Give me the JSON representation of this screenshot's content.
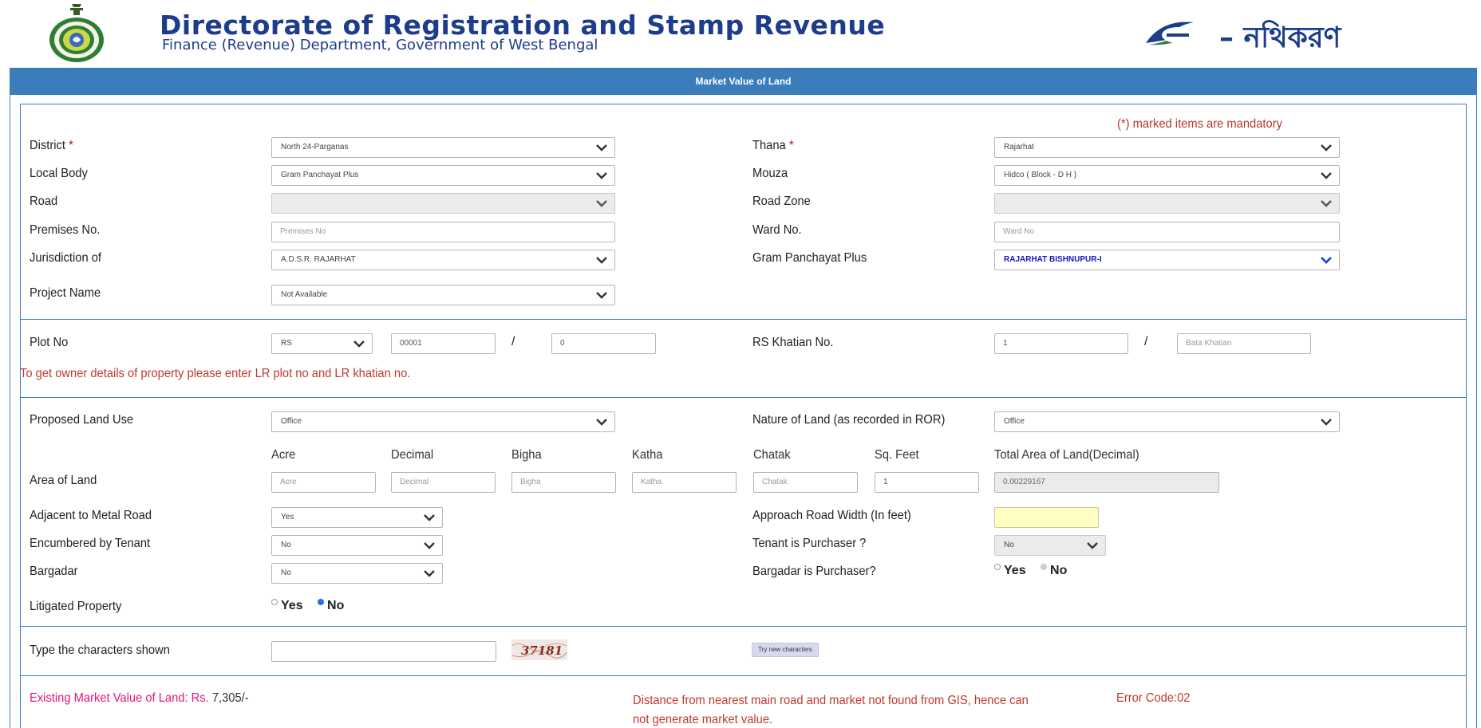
{
  "header": {
    "title": "Directorate of Registration and Stamp Revenue",
    "subtitle": "Finance (Revenue) Department, Government of West Bengal",
    "logo_text": "– নথিকরণ"
  },
  "bar_title": "Market Value of Land",
  "mandatory_note": "(*) marked items are mandatory",
  "required_mark": "*",
  "fields": {
    "district": {
      "label": "District",
      "value": "North 24-Parganas"
    },
    "thana": {
      "label": "Thana",
      "value": "Rajarhat"
    },
    "local_body": {
      "label": "Local Body",
      "value": "Gram Panchayat Plus"
    },
    "mouza": {
      "label": "Mouza",
      "value": "Hidco ( Block - D H )"
    },
    "road": {
      "label": "Road",
      "value": ""
    },
    "road_zone": {
      "label": "Road Zone",
      "value": ""
    },
    "premises_no": {
      "label": "Premises No.",
      "placeholder": "Premises No"
    },
    "ward_no": {
      "label": "Ward No.",
      "placeholder": "Ward No"
    },
    "jurisdiction": {
      "label": "Jurisdiction of",
      "value": "A.D.S.R. RAJARHAT"
    },
    "gram_panchayat": {
      "label": "Gram Panchayat Plus",
      "value": "RAJARHAT BISHNUPUR-I"
    },
    "project_name": {
      "label": "Project Name",
      "value": "Not Available"
    },
    "plot_no": {
      "label": "Plot No",
      "type_value": "RS",
      "plot_value": "00001",
      "sub_value": "0"
    },
    "rs_khatian": {
      "label": "RS Khatian No.",
      "value": "1",
      "bata_placeholder": "Bata Khatian"
    },
    "owner_note": "To get owner details of property please enter LR plot no and LR khatian no.",
    "proposed_land_use": {
      "label": "Proposed Land Use",
      "value": "Office"
    },
    "nature_of_land": {
      "label": "Nature of Land (as recorded in ROR)",
      "value": "Office"
    },
    "area": {
      "label": "Area of Land",
      "headers": [
        "Acre",
        "Decimal",
        "Bigha",
        "Katha",
        "Chatak",
        "Sq. Feet",
        "Total Area of Land(Decimal)"
      ],
      "placeholders": [
        "Acre",
        "Decimal",
        "Bigha",
        "Katha",
        "Chatak"
      ],
      "sq_feet_value": "1",
      "total_value": "0.00229167"
    },
    "adjacent_metal_road": {
      "label": "Adjacent to Metal Road",
      "value": "Yes"
    },
    "approach_road_width": {
      "label": "Approach Road Width (In feet)",
      "value": ""
    },
    "encumbered_by_tenant": {
      "label": "Encumbered by Tenant",
      "value": "No"
    },
    "tenant_is_purchaser": {
      "label": "Tenant is Purchaser ?",
      "value": "No"
    },
    "bargadar": {
      "label": "Bargadar",
      "value": "No"
    },
    "bargadar_is_purchaser": {
      "label": "Bargadar is Purchaser?",
      "yes": "Yes",
      "no": "No"
    },
    "litigated_property": {
      "label": "Litigated Property",
      "yes": "Yes",
      "no": "No",
      "selected": "No"
    },
    "captcha": {
      "label": "Type the characters shown",
      "value": "",
      "image_text": "37181",
      "try_label": "Try new characters"
    }
  },
  "result": {
    "existing_label": "Existing Market Value of Land: Rs.",
    "existing_amount": "7,305/-",
    "gis_message": "Distance from nearest main road and market not found from GIS, hence can not generate market value.",
    "error_code": "Error Code:02"
  },
  "colors": {
    "primary_blue": "#3a7dba",
    "title_blue": "#1d3d8c",
    "error_red": "#c0392b",
    "pink": "#e8157c",
    "highlight_yellow": "#ffffc4"
  }
}
